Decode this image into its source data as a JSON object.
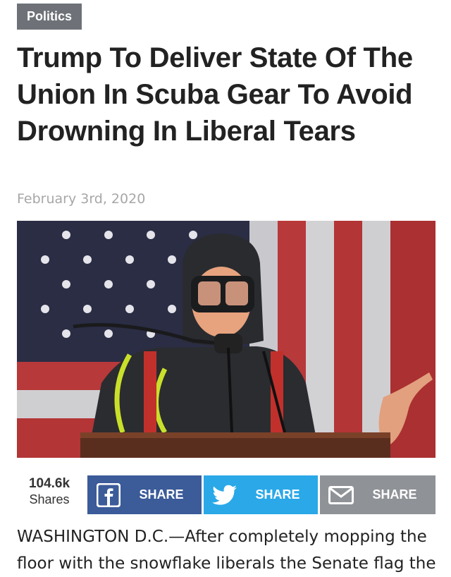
{
  "article": {
    "category": "Politics",
    "title": "Trump To Deliver State Of The Union In Scuba Gear To Avoid Drowning In Liberal Tears",
    "date": "February 3rd, 2020",
    "body_preview": "WASHINGTON D.C.—After completely mopping the floor with the snowflake liberals the Senate flag the"
  },
  "hero_image": {
    "description_icon": "photo"
  },
  "share_bar": {
    "count": "104.6k",
    "count_label": "Shares",
    "buttons": [
      {
        "network": "facebook",
        "icon": "facebook-icon",
        "label": "SHARE",
        "color": "#3b5b99"
      },
      {
        "network": "twitter",
        "icon": "twitter-bird-icon",
        "label": "SHARE",
        "color": "#2aa8e8"
      },
      {
        "network": "email",
        "icon": "envelope-icon",
        "label": "SHARE",
        "color": "#8f9397"
      }
    ]
  }
}
